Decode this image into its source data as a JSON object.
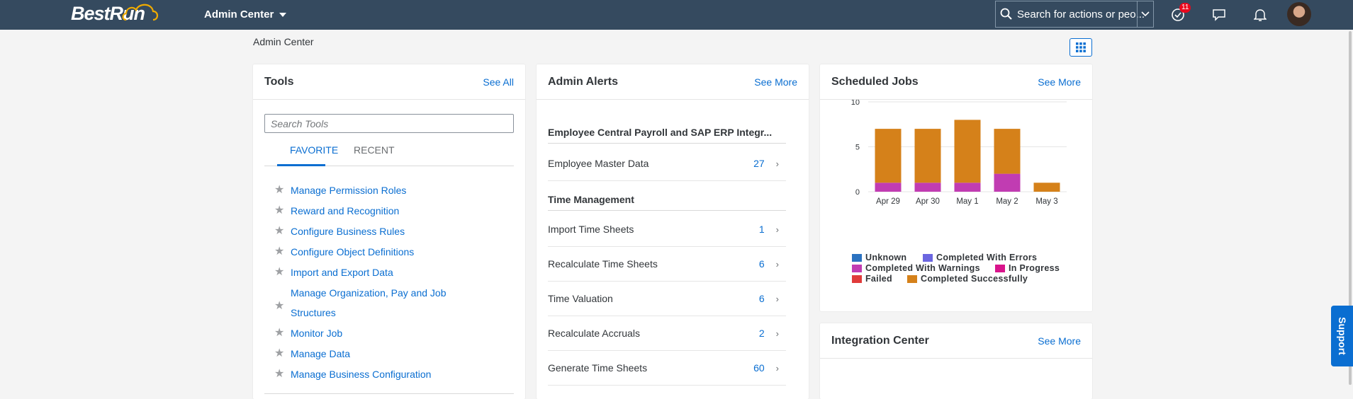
{
  "shell": {
    "logo_text": "BestRun",
    "app_title": "Admin Center",
    "search_placeholder": "Search for actions or peo...",
    "notification_badge": "11"
  },
  "breadcrumb": "Admin Center",
  "tools": {
    "title": "Tools",
    "see_all": "See All",
    "search_placeholder": "Search Tools",
    "tabs": [
      "FAVORITE",
      "RECENT"
    ],
    "items": [
      "Manage Permission Roles",
      "Reward and Recognition",
      "Configure Business Rules",
      "Configure Object Definitions",
      "Import and Export Data",
      "Manage Organization, Pay and Job Structures",
      "Monitor Job",
      "Manage Data",
      "Manage Business Configuration"
    ]
  },
  "alerts": {
    "title": "Admin Alerts",
    "see_more": "See More",
    "sections": [
      {
        "header": "Employee Central Payroll and SAP ERP Integr...",
        "rows": [
          {
            "label": "Employee Master Data",
            "count": "27"
          }
        ]
      },
      {
        "header": "Time Management",
        "rows": [
          {
            "label": "Import Time Sheets",
            "count": "1"
          },
          {
            "label": "Recalculate Time Sheets",
            "count": "6"
          },
          {
            "label": "Time Valuation",
            "count": "6"
          },
          {
            "label": "Recalculate Accruals",
            "count": "2"
          },
          {
            "label": "Generate Time Sheets",
            "count": "60"
          }
        ]
      }
    ]
  },
  "scheduled_jobs": {
    "title": "Scheduled Jobs",
    "see_more": "See More"
  },
  "integration_center": {
    "title": "Integration Center",
    "see_more": "See More"
  },
  "support_label": "Support",
  "colors": {
    "shell": "#354a5f",
    "accent": "#0a6ed1",
    "completed_successfully": "#d5811a",
    "completed_with_warnings": "#c13cb2"
  },
  "chart_data": {
    "type": "bar",
    "categories": [
      "Apr 29",
      "Apr 30",
      "May 1",
      "May 2",
      "May 3"
    ],
    "series": [
      {
        "name": "Unknown",
        "color": "#2b72c0",
        "values": [
          0,
          0,
          0,
          0,
          0
        ]
      },
      {
        "name": "Completed With Errors",
        "color": "#6b66e0",
        "values": [
          0,
          0,
          0,
          0,
          0
        ]
      },
      {
        "name": "Completed With Warnings",
        "color": "#c13cb2",
        "values": [
          1,
          1,
          1,
          2,
          0
        ]
      },
      {
        "name": "In Progress",
        "color": "#d9148c",
        "values": [
          0,
          0,
          0,
          0,
          0
        ]
      },
      {
        "name": "Failed",
        "color": "#e03a3a",
        "values": [
          0,
          0,
          0,
          0,
          0
        ]
      },
      {
        "name": "Completed Successfully",
        "color": "#d5811a",
        "values": [
          6,
          6,
          7,
          5,
          1
        ]
      }
    ],
    "yticks": [
      0,
      5,
      10
    ],
    "ylim": [
      0,
      10
    ],
    "stacked": true,
    "legend_position": "bottom",
    "grid": true
  }
}
